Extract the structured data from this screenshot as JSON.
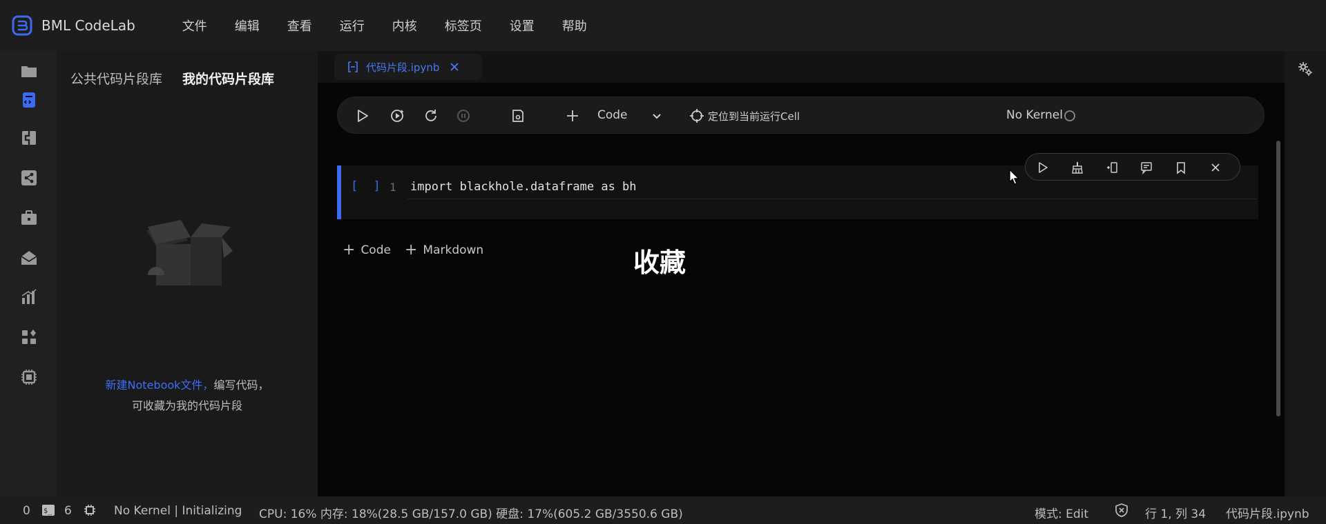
{
  "app": {
    "name": "BML CodeLab"
  },
  "menu": [
    "文件",
    "编辑",
    "查看",
    "运行",
    "内核",
    "标签页",
    "设置",
    "帮助"
  ],
  "activity_icons": [
    "folder-icon",
    "code-snippet-icon",
    "package-icon",
    "share-nodes-icon",
    "toolbox-icon",
    "mail-open-icon",
    "chart-icon",
    "widgets-icon",
    "chip-icon"
  ],
  "left_panel": {
    "tabs": [
      "公共代码片段库",
      "我的代码片段库"
    ],
    "active_tab": 1,
    "empty_link": "新建Notebook文件，",
    "empty_text1": "编写代码，",
    "empty_text2": "可收藏为我的代码片段"
  },
  "file_tab": {
    "name": "代码片段.ipynb"
  },
  "toolbar": {
    "cell_type": "Code",
    "locate": "定位到当前运行Cell",
    "kernel": "No Kernel"
  },
  "cell": {
    "prompt": "[ ]",
    "line_number": "1",
    "code": "import blackhole.dataframe as bh"
  },
  "add": {
    "code": "Code",
    "markdown": "Markdown"
  },
  "overlay_label": "收藏",
  "status": {
    "count1": "0",
    "count2": "6",
    "kernel_state": "No Kernel | Initializing",
    "resources": "CPU:  16% 内存:  18%(28.5 GB/157.0 GB) 硬盘:  17%(605.2 GB/3550.6 GB)",
    "mode": "模式:  Edit",
    "position": "行 1, 列 34",
    "file": "代码片段.ipynb"
  },
  "colors": {
    "accent": "#3c6af0",
    "bg": "#060606",
    "panel": "#1a1a1a"
  }
}
